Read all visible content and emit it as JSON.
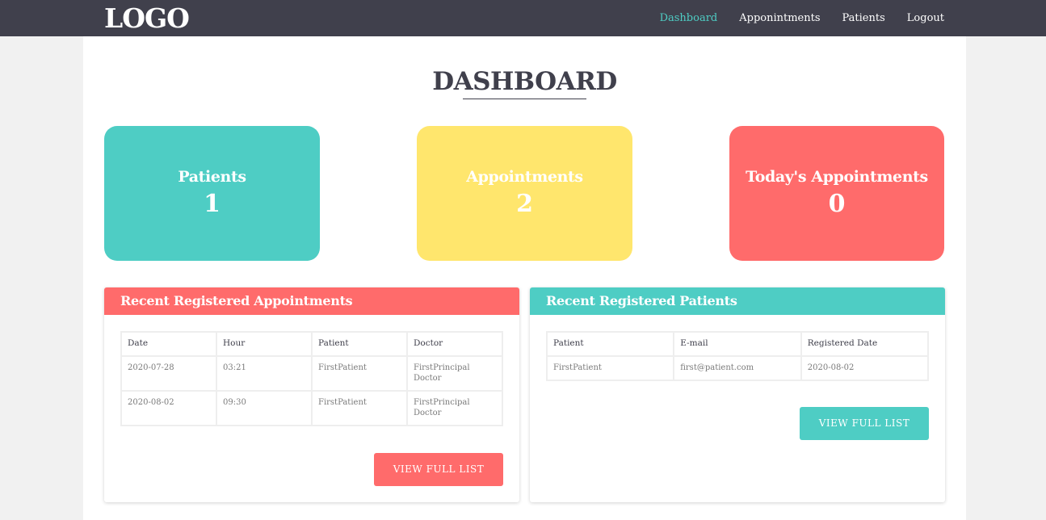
{
  "navbar": {
    "logo": "LOGO",
    "links": [
      "Dashboard",
      "Apponintments",
      "Patients",
      "Logout"
    ]
  },
  "page": {
    "title": "DASHBOARD"
  },
  "stats": {
    "patients": {
      "label": "Patients",
      "value": "1"
    },
    "appointments": {
      "label": "Appointments",
      "value": "2"
    },
    "today": {
      "label": "Today's Appointments",
      "value": "0"
    }
  },
  "recent_appointments": {
    "title": "Recent Registered Appointments",
    "columns": [
      "Date",
      "Hour",
      "Patient",
      "Doctor"
    ],
    "rows": [
      [
        "2020-07-28",
        "03:21",
        "FirstPatient",
        "FirstPrincipal Doctor"
      ],
      [
        "2020-08-02",
        "09:30",
        "FirstPatient",
        "FirstPrincipal Doctor"
      ]
    ],
    "button_label": "VIEW FULL LIST"
  },
  "recent_patients": {
    "title": "Recent Registered Patients",
    "columns": [
      "Patient",
      "E-mail",
      "Registered Date"
    ],
    "rows": [
      [
        "FirstPatient",
        "first@patient.com",
        "2020-08-02"
      ]
    ],
    "button_label": "VIEW FULL LIST"
  },
  "colors": {
    "navbar": "#40404c",
    "teal": "#4ecdc4",
    "yellow": "#ffe66d",
    "coral": "#ff6b6b"
  }
}
